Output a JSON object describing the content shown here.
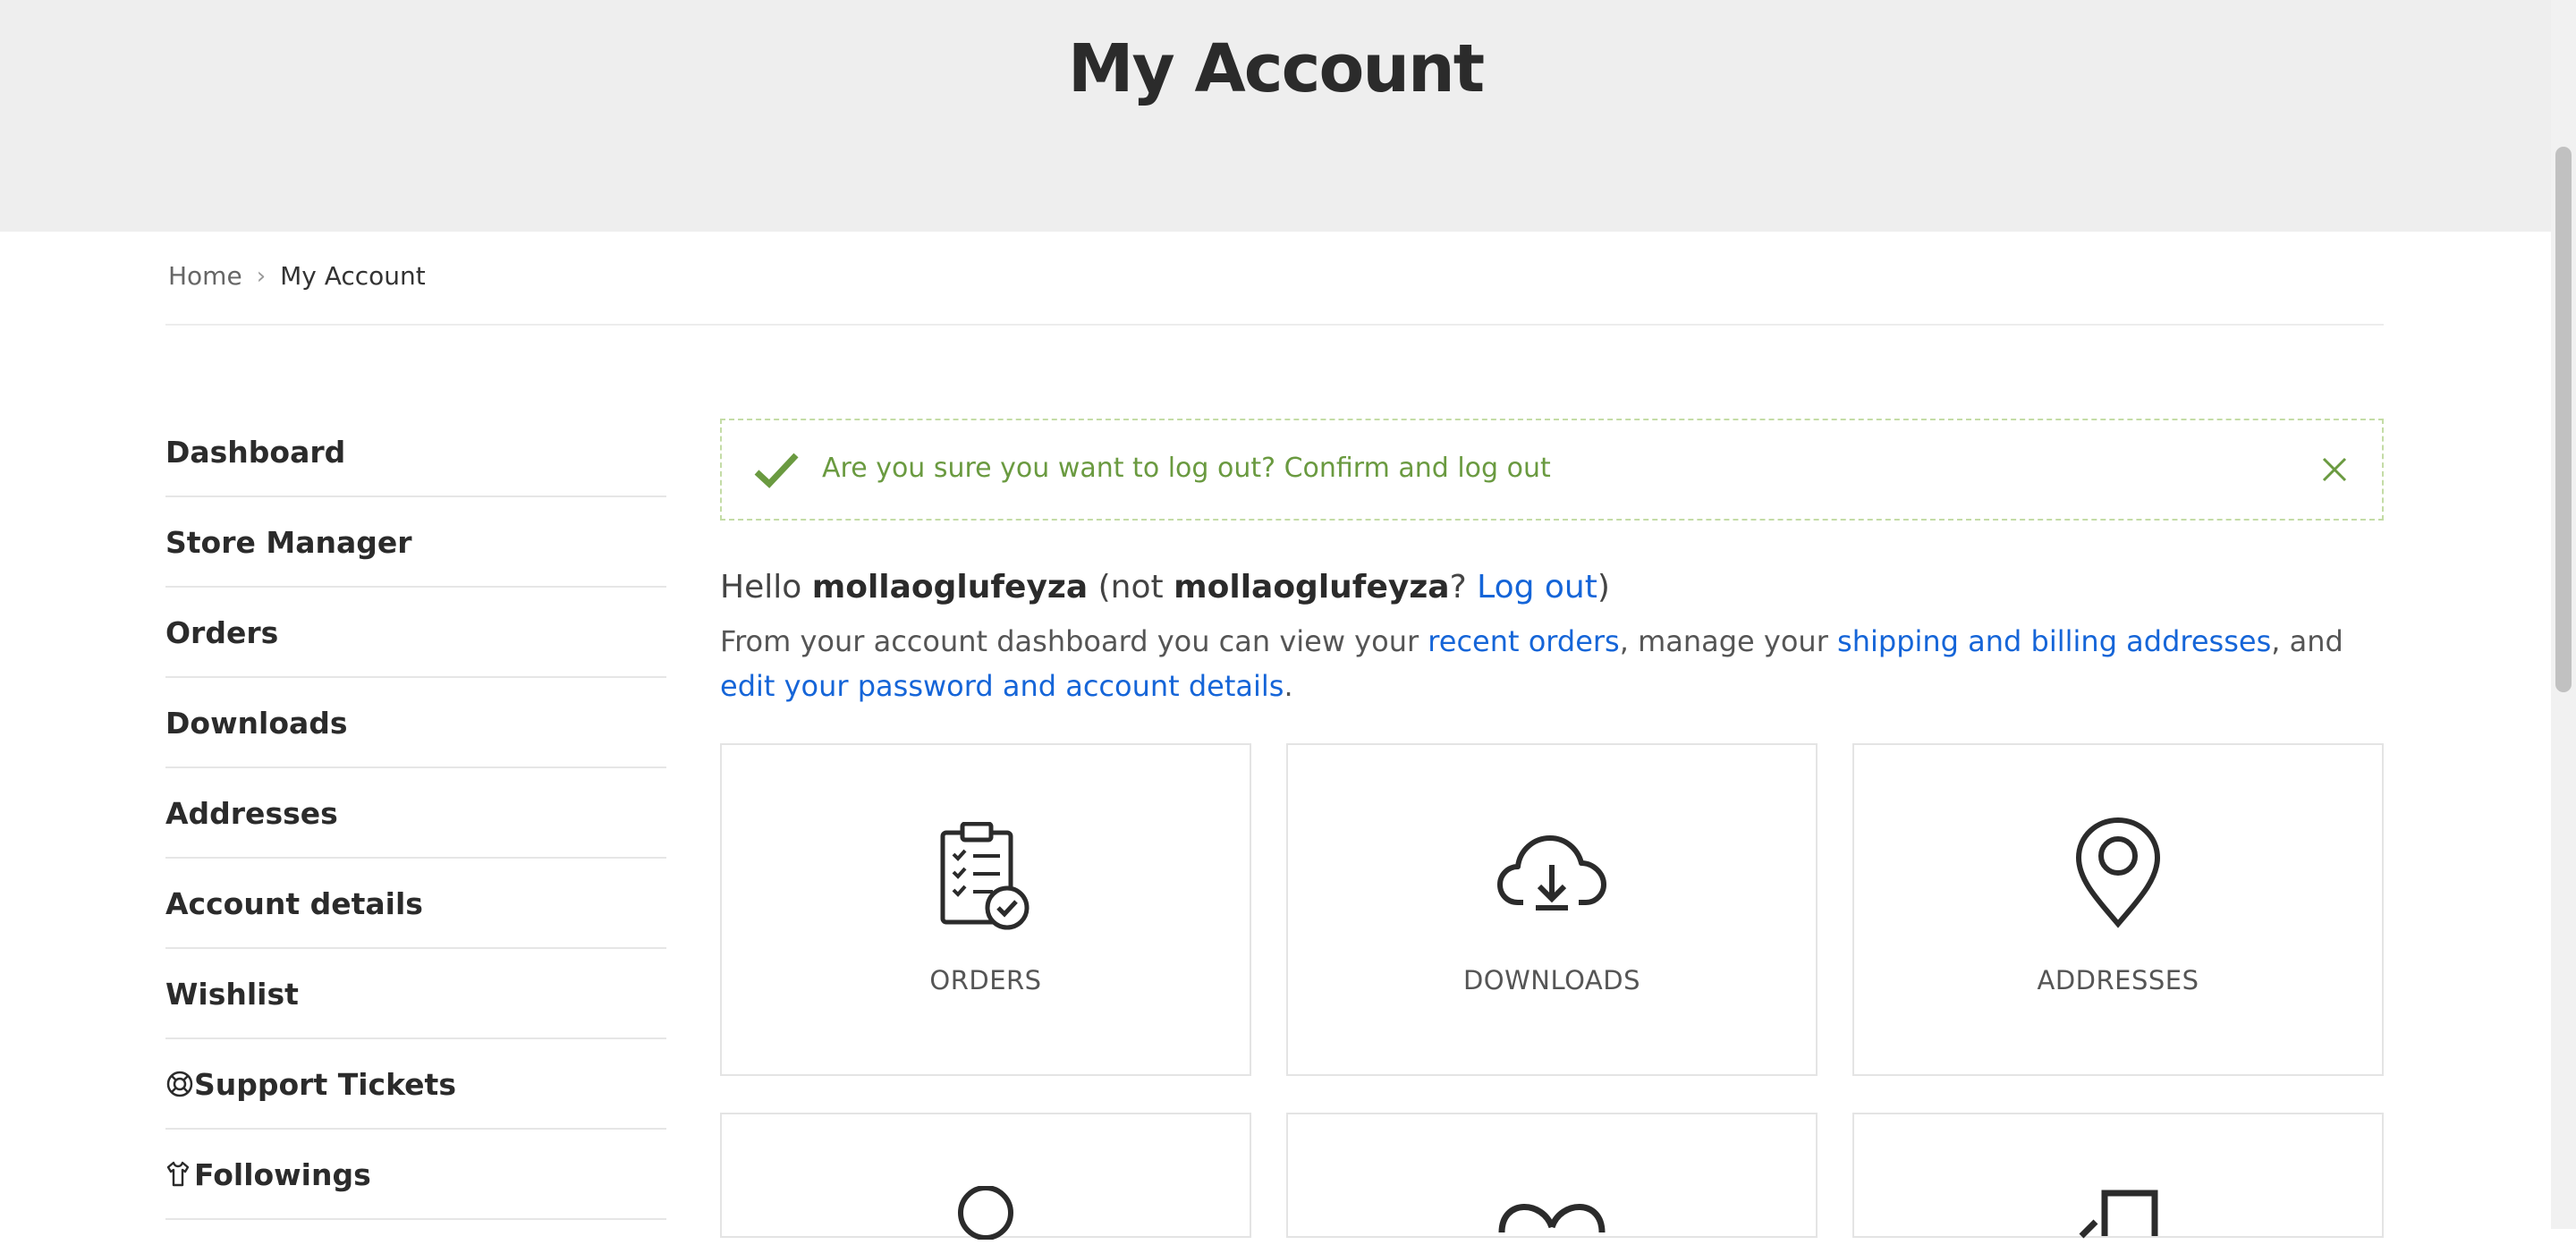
{
  "page": {
    "title": "My Account"
  },
  "breadcrumb": {
    "home": "Home",
    "separator": "›",
    "current": "My Account"
  },
  "sidebar": {
    "items": [
      {
        "label": "Dashboard"
      },
      {
        "label": "Store Manager"
      },
      {
        "label": "Orders"
      },
      {
        "label": "Downloads"
      },
      {
        "label": "Addresses"
      },
      {
        "label": "Account details"
      },
      {
        "label": "Wishlist"
      },
      {
        "label": "Support Tickets",
        "icon": "lifebuoy-icon"
      },
      {
        "label": "Followings",
        "icon": "shirt-icon"
      }
    ]
  },
  "notice": {
    "message": "Are you sure you want to log out? Confirm and log out",
    "icon": "check-icon",
    "close_icon": "close-icon",
    "color": "#6a9a40",
    "border_color": "#c4dca6"
  },
  "greeting": {
    "hello": "Hello",
    "username": "mollaoglufeyza",
    "open_paren": "(not",
    "username2": "mollaoglufeyza",
    "question": "?",
    "logout_link": "Log out",
    "close_paren": ")"
  },
  "description": {
    "part1": "From your account dashboard you can view your",
    "link_orders": "recent orders",
    "part2": ", manage your",
    "link_addresses": "shipping and billing addresses",
    "part3": ", and",
    "link_account": "edit your password and account details",
    "part4": "."
  },
  "cards": [
    {
      "label": "ORDERS",
      "icon": "clipboard-check-icon"
    },
    {
      "label": "DOWNLOADS",
      "icon": "cloud-download-icon"
    },
    {
      "label": "ADDRESSES",
      "icon": "map-pin-icon"
    }
  ],
  "colors": {
    "link": "#1565d8",
    "hero_bg": "#eeeeee"
  }
}
